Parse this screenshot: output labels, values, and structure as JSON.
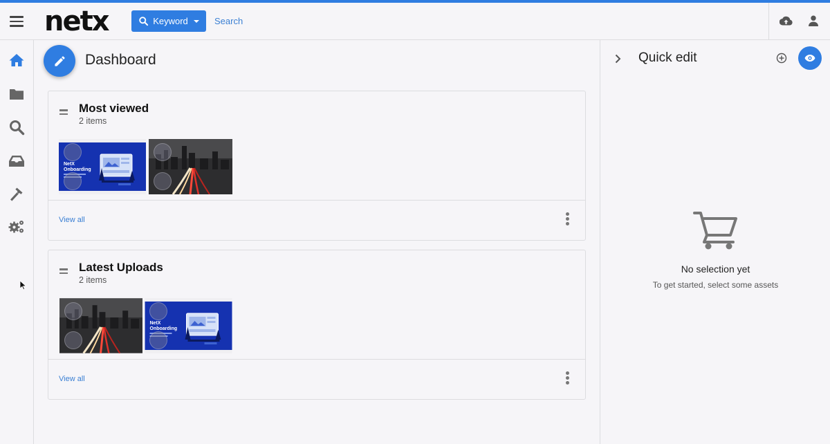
{
  "header": {
    "logo": "netx",
    "keyword_button": "Keyword",
    "search_placeholder": "Search"
  },
  "sidebar": {
    "items": [
      {
        "icon": "home-icon",
        "active": true
      },
      {
        "icon": "folder-icon",
        "active": false
      },
      {
        "icon": "search-icon",
        "active": false
      },
      {
        "icon": "inbox-icon",
        "active": false
      },
      {
        "icon": "hammer-icon",
        "active": false
      },
      {
        "icon": "gears-icon",
        "active": false
      }
    ]
  },
  "main": {
    "title": "Dashboard",
    "cards": [
      {
        "title": "Most viewed",
        "count": "2 items",
        "view_all": "View all",
        "thumbs": [
          "NetX Onboarding",
          "City highway at night"
        ]
      },
      {
        "title": "Latest Uploads",
        "count": "2 items",
        "view_all": "View all",
        "thumbs": [
          "City highway at night",
          "NetX Onboarding"
        ]
      }
    ],
    "thumb_text": {
      "netx": "NetX",
      "onboarding": "Onboarding"
    }
  },
  "quick_edit": {
    "title": "Quick edit",
    "empty_title": "No selection yet",
    "empty_subtitle": "To get started, select some assets"
  },
  "colors": {
    "accent": "#2f7de1",
    "link": "#3a7fd3",
    "background": "#f6f5f8",
    "onboarding_blue": "#1532b0"
  }
}
